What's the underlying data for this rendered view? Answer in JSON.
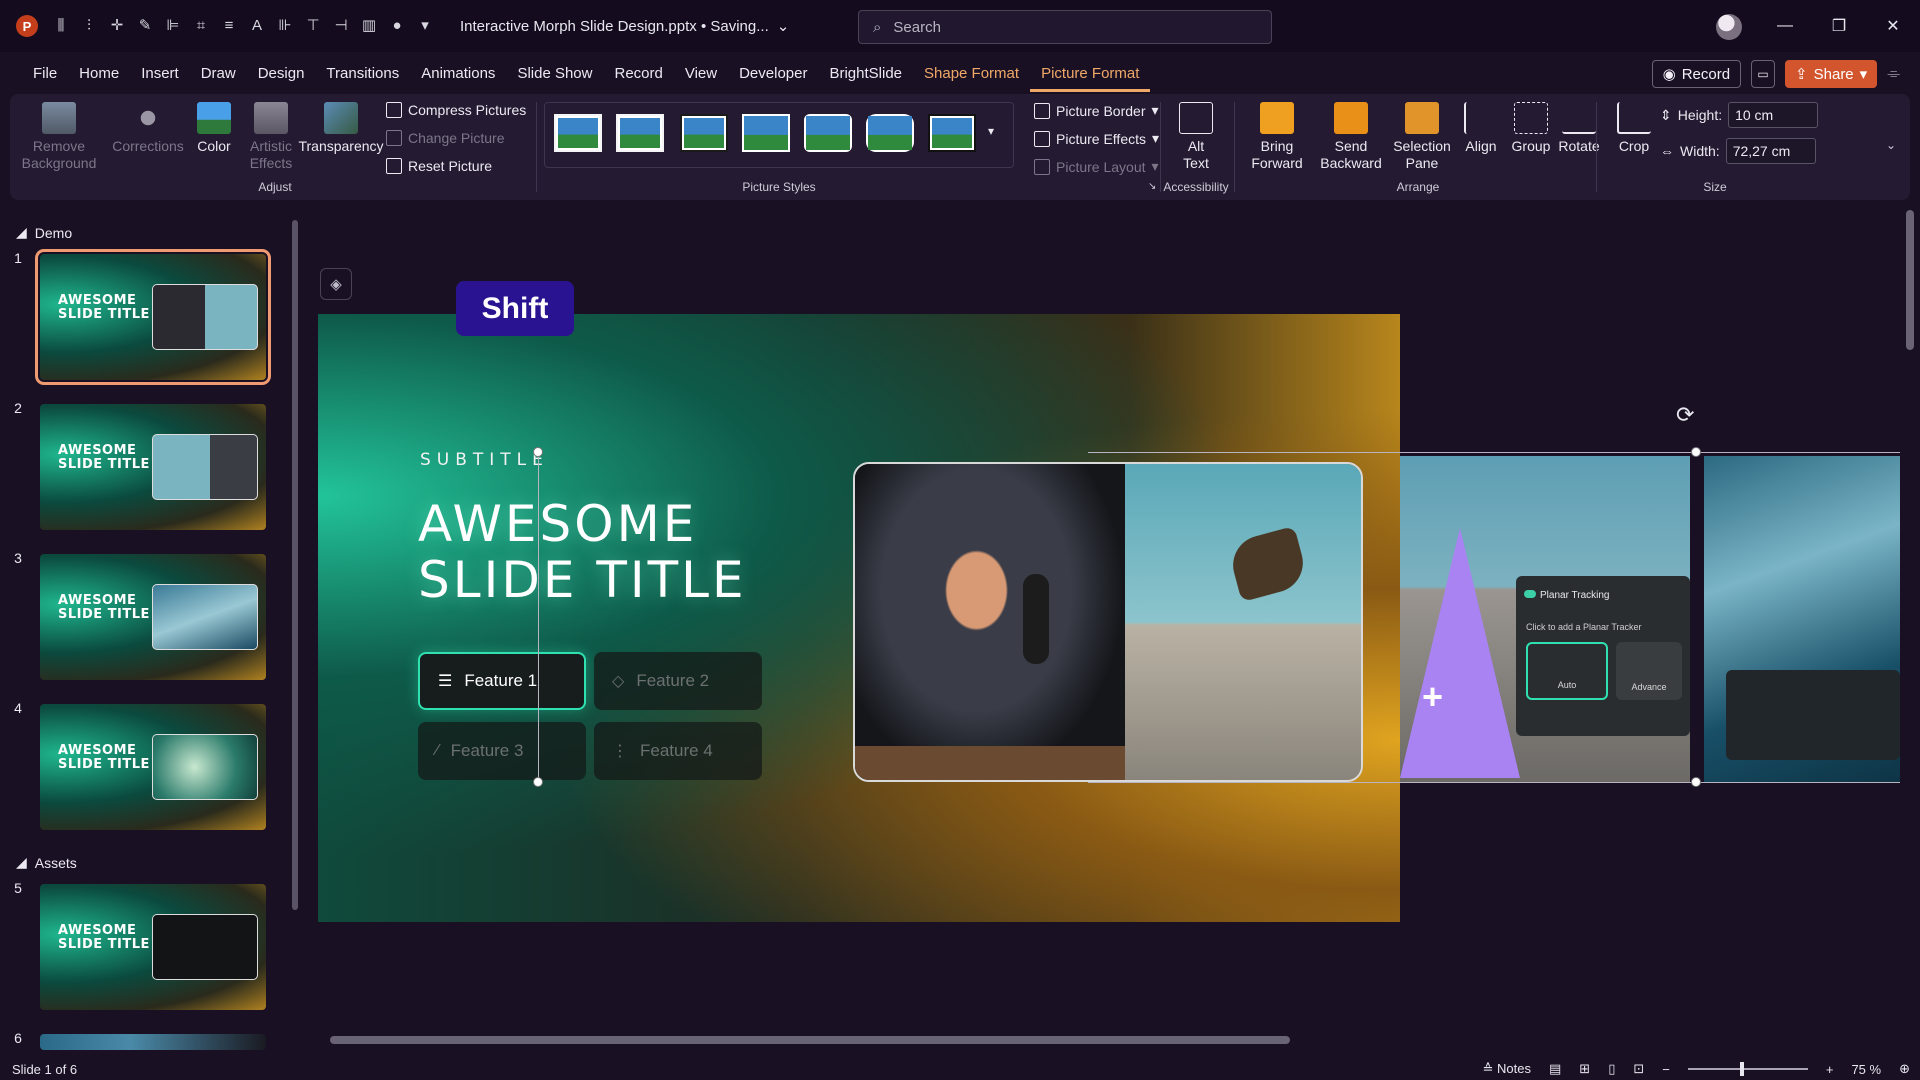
{
  "titlebar": {
    "app_logo": "P",
    "doc_title": "Interactive Morph Slide Design.pptx • Saving...",
    "search_placeholder": "Search"
  },
  "menu": {
    "tabs": [
      "File",
      "Home",
      "Insert",
      "Draw",
      "Design",
      "Transitions",
      "Animations",
      "Slide Show",
      "Record",
      "View",
      "Developer",
      "BrightSlide",
      "Shape Format",
      "Picture Format"
    ],
    "active_tab": "Picture Format",
    "record_label": "Record",
    "share_label": "Share"
  },
  "ribbon": {
    "adjust": {
      "remove_background": "Remove Background",
      "corrections": "Corrections",
      "color": "Color",
      "artistic_effects": "Artistic Effects",
      "transparency": "Transparency",
      "compress_pictures": "Compress Pictures",
      "change_picture": "Change Picture",
      "reset_picture": "Reset Picture",
      "group_label": "Adjust"
    },
    "picture_styles": {
      "group_label": "Picture Styles",
      "picture_border": "Picture Border",
      "picture_effects": "Picture Effects",
      "picture_layout": "Picture Layout"
    },
    "accessibility": {
      "alt_text": "Alt Text",
      "group_label": "Accessibility"
    },
    "arrange": {
      "bring_forward": "Bring Forward",
      "send_backward": "Send Backward",
      "selection_pane": "Selection Pane",
      "align": "Align",
      "group": "Group",
      "rotate": "Rotate",
      "group_label": "Arrange"
    },
    "size": {
      "crop": "Crop",
      "height_label": "Height:",
      "height_value": "10 cm",
      "width_label": "Width:",
      "width_value": "72,27 cm",
      "group_label": "Size"
    }
  },
  "slide_panel": {
    "section_demo": "Demo",
    "section_assets": "Assets",
    "slide_numbers": [
      "1",
      "2",
      "3",
      "4",
      "5",
      "6"
    ],
    "selected_slide": 1
  },
  "slide": {
    "subtitle": "SUBTITLE",
    "title_line1": "AWESOME",
    "title_line2": "SLIDE TITLE",
    "features": [
      "Feature 1",
      "Feature 2",
      "Feature 3",
      "Feature 4"
    ],
    "shift_badge": "Shift"
  },
  "offslide": {
    "planar_tracking": "Planar Tracking",
    "planar_hint": "Click to add a Planar Tracker",
    "auto_label": "Auto",
    "advance_label": "Advance"
  },
  "statusbar": {
    "slide_info": "Slide 1 of 6",
    "notes_label": "Notes",
    "zoom": "75 %"
  },
  "colors": {
    "accent_orange": "#f0a868",
    "share_button": "#d2552e",
    "feature_active_border": "#2fe0b0",
    "shift_badge": "#2a1390"
  }
}
